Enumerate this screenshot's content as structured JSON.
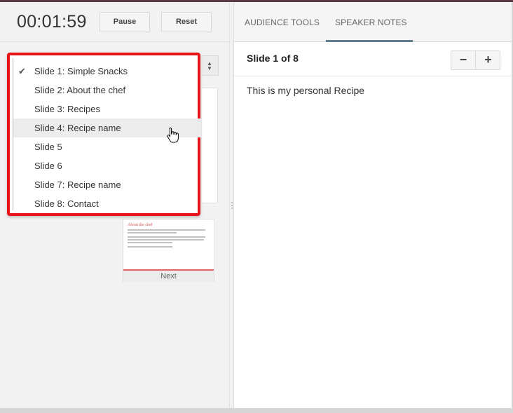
{
  "presenter": {
    "timer": "00:01:59",
    "pause_label": "Pause",
    "reset_label": "Reset",
    "slide_select": {
      "selected_index": 0,
      "hovered_index": 3,
      "options": [
        {
          "label": "Slide 1: Simple Snacks"
        },
        {
          "label": "Slide 2: About the chef"
        },
        {
          "label": "Slide 3: Recipes"
        },
        {
          "label": "Slide 4: Recipe name"
        },
        {
          "label": "Slide 5"
        },
        {
          "label": "Slide 6"
        },
        {
          "label": "Slide 7: Recipe name"
        },
        {
          "label": "Slide 8: Contact"
        }
      ]
    },
    "next_preview": {
      "slide_title": "About the chef",
      "label": "Next"
    }
  },
  "right_panel": {
    "tabs": [
      {
        "label": "AUDIENCE TOOLS",
        "active": false
      },
      {
        "label": "SPEAKER NOTES",
        "active": true
      }
    ],
    "slide_counter": "Slide 1 of 8",
    "zoom_out_label": "−",
    "zoom_in_label": "+",
    "notes": "This is my personal Recipe"
  },
  "colors": {
    "highlight_border": "#e8141b",
    "tab_underline": "#5f7d8c",
    "title_bar": "#5a3a44"
  }
}
